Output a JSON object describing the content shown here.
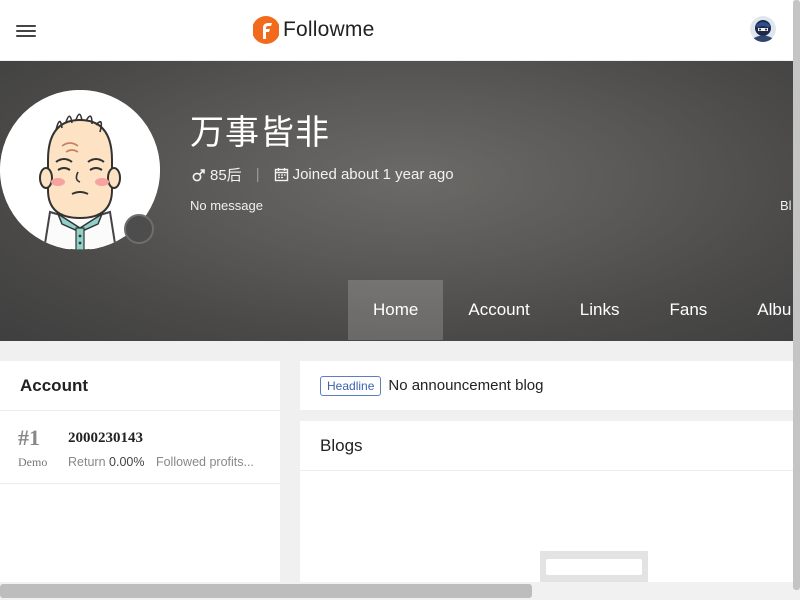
{
  "header": {
    "brand": "Followme",
    "menu_icon": "hamburger-menu-icon",
    "brand_color": "#f26b1d"
  },
  "profile": {
    "name": "万事皆非",
    "gender_icon": "male-icon",
    "age_group": "85后",
    "joined_icon": "calendar-icon",
    "joined": "Joined about 1 year ago",
    "message": "No message",
    "truncated_right_text": "Bl"
  },
  "tabs": [
    {
      "label": "Home",
      "active": true
    },
    {
      "label": "Account",
      "active": false
    },
    {
      "label": "Links",
      "active": false
    },
    {
      "label": "Fans",
      "active": false
    },
    {
      "label": "Albu",
      "active": false
    }
  ],
  "account_card": {
    "title": "Account",
    "accounts": [
      {
        "rank": "#1",
        "type": "Demo",
        "number": "2000230143",
        "return_label": "Return",
        "return_value": "0.00%",
        "followed": "Followed profits..."
      }
    ]
  },
  "announcement": {
    "badge": "Headline",
    "text": "No announcement blog",
    "badge_color": "#3d63ad"
  },
  "blogs": {
    "title": "Blogs"
  }
}
